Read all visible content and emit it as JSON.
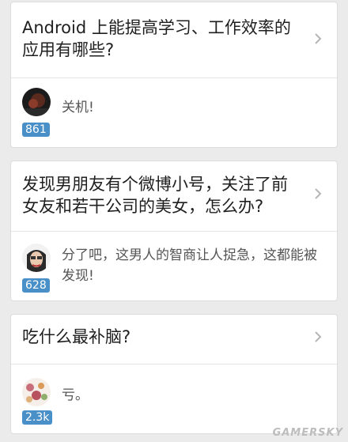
{
  "cards": [
    {
      "question": "Android 上能提高学习、工作效率的应用有哪些?",
      "answer": "关机!",
      "votes": "861"
    },
    {
      "question": "发现男朋友有个微博小号，关注了前女友和若干公司的美女，怎么办?",
      "answer": "分了吧，这男人的智商让人捉急，这都能被发现!",
      "votes": "628"
    },
    {
      "question": "吃什么最补脑?",
      "answer": "亏。",
      "votes": "2.3k"
    }
  ],
  "watermark": "GAMERSKY",
  "colors": {
    "background": "#ebebeb",
    "card": "#ffffff",
    "vote_badge": "#4a90c8",
    "chevron": "#b5b5b5"
  }
}
